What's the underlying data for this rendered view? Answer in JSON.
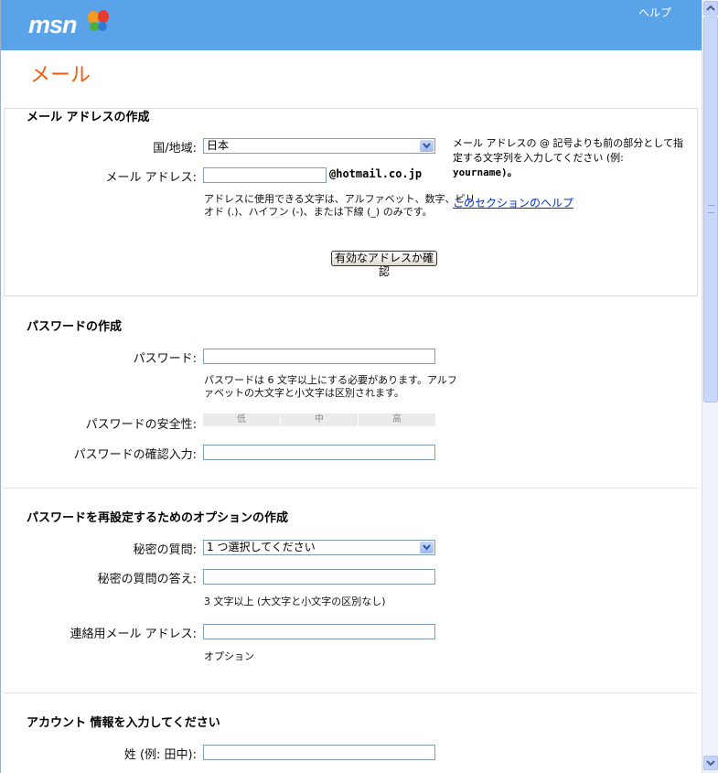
{
  "header": {
    "logo_text": "msn",
    "help": "ヘルプ"
  },
  "page_title": "メール",
  "email_section": {
    "title": "メール アドレスの作成",
    "country_label": "国/地域:",
    "country_value": "日本",
    "email_label": "メール アドレス:",
    "email_value": "",
    "domain": "@hotmail.co.jp",
    "hint_line1": "アドレスに使用できる文字は、アルファベット、数字、ピリ",
    "hint_line2": "オド (.)、ハイフン (-)、または下線 (_) のみです。",
    "check_button": "有効なアドレスか確認",
    "side_help_line1": "メール アドレスの @ 記号よりも前の部分として指",
    "side_help_line2": "定する文字列を入力してください (例:",
    "side_help_line3": "yourname)。",
    "side_link": "このセクションのヘルプ"
  },
  "password_section": {
    "title": "パスワードの作成",
    "password_label": "パスワード:",
    "hint_line1": "パスワードは 6 文字以上にする必要があります。アルフ",
    "hint_line2": "ァベットの大文字と小文字は区別されます。",
    "strength_label": "パスワードの安全性:",
    "strength_levels": [
      "低",
      "中",
      "高"
    ],
    "confirm_label": "パスワードの確認入力:"
  },
  "reset_section": {
    "title": "パスワードを再設定するためのオプションの作成",
    "question_label": "秘密の質問:",
    "question_value": "1 つ選択してください",
    "answer_label": "秘密の質問の答え:",
    "answer_hint": "3 文字以上 (大文字と小文字の区別なし)",
    "alt_email_label": "連絡用メール アドレス:",
    "alt_email_hint": "オプション"
  },
  "account_section": {
    "title": "アカウント 情報を入力してください",
    "lastname_label": "姓 (例: 田中):"
  },
  "colors": {
    "header_bg": "#5ba3e8",
    "title_orange": "#f25c0f",
    "link_blue": "#0033cc"
  }
}
